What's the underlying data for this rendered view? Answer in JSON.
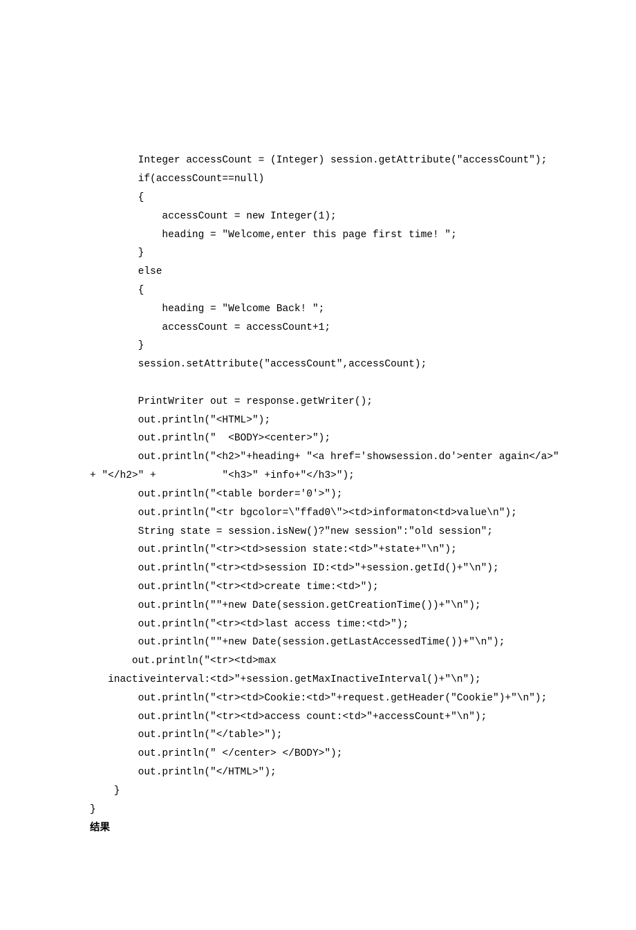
{
  "code": {
    "l1": "        Integer accessCount = (Integer) session.getAttribute(\"accessCount\");",
    "l2": "        if(accessCount==null)",
    "l3": "        {",
    "l4": "            accessCount = new Integer(1);",
    "l5": "            heading = \"Welcome,enter this page first time! \";",
    "l6": "        }",
    "l7": "        else",
    "l8": "        {",
    "l9": "            heading = \"Welcome Back! \";",
    "l10": "            accessCount = accessCount+1;",
    "l11": "        }",
    "l12": "        session.setAttribute(\"accessCount\",accessCount);",
    "l13": "",
    "l14": "        PrintWriter out = response.getWriter();",
    "l15": "        out.println(\"<HTML>\");",
    "l16": "        out.println(\"  <BODY><center>\");",
    "l17": "        out.println(\"<h2>\"+heading+ \"<a href='showsession.do'>enter again</a>\"",
    "l18": "+ \"</h2>\" +           \"<h3>\" +info+\"</h3>\");",
    "l19": "        out.println(\"<table border='0'>\");",
    "l20": "        out.println(\"<tr bgcolor=\\\"ffad0\\\"><td>informaton<td>value\\n\");",
    "l21": "        String state = session.isNew()?\"new session\":\"old session\";",
    "l22": "        out.println(\"<tr><td>session state:<td>\"+state+\"\\n\");",
    "l23": "        out.println(\"<tr><td>session ID:<td>\"+session.getId()+\"\\n\");",
    "l24": "        out.println(\"<tr><td>create time:<td>\");",
    "l25": "        out.println(\"\"+new Date(session.getCreationTime())+\"\\n\");",
    "l26": "        out.println(\"<tr><td>last access time:<td>\");",
    "l27": "        out.println(\"\"+new Date(session.getLastAccessedTime())+\"\\n\");",
    "l28": "       out.println(\"<tr><td>max",
    "l29": "   inactiveinterval:<td>\"+session.getMaxInactiveInterval()+\"\\n\");",
    "l30": "        out.println(\"<tr><td>Cookie:<td>\"+request.getHeader(\"Cookie\")+\"\\n\");",
    "l31": "        out.println(\"<tr><td>access count:<td>\"+accessCount+\"\\n\");",
    "l32": "        out.println(\"</table>\");",
    "l33": "        out.println(\" </center> </BODY>\");",
    "l34": "        out.println(\"</HTML>\");",
    "l35": "    }",
    "l36": "}"
  },
  "result_label": "结果"
}
